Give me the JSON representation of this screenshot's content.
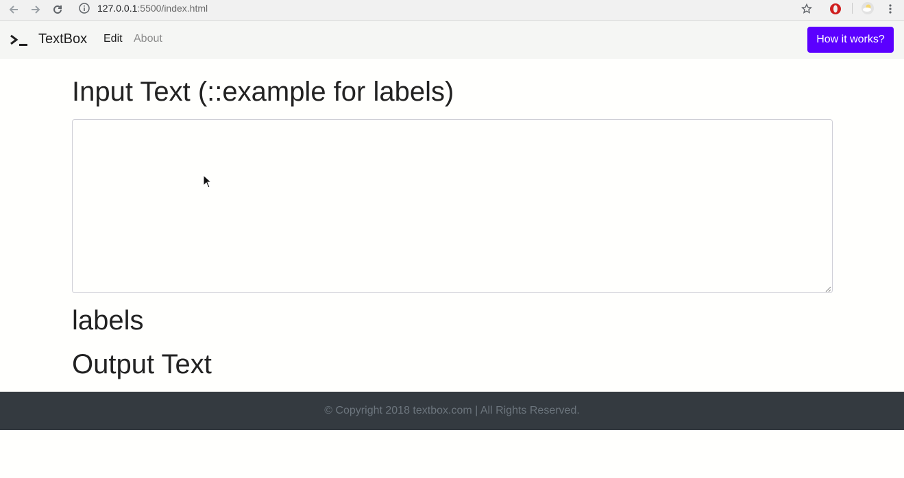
{
  "browser": {
    "url_host": "127.0.0.1",
    "url_rest": ":5500/index.html"
  },
  "navbar": {
    "brand": "TextBox",
    "links": [
      "Edit",
      "About"
    ],
    "cta_label": "How it works?"
  },
  "main": {
    "input_title": "Input Text (::example for labels)",
    "input_value": "",
    "labels_title": "labels",
    "output_title": "Output Text"
  },
  "footer": {
    "text": "© Copyright 2018 textbox.com | All Rights Reserved."
  },
  "colors": {
    "accent": "#5b00ff",
    "footer_bg": "#343a40",
    "navbar_bg": "#f5f6f4"
  }
}
